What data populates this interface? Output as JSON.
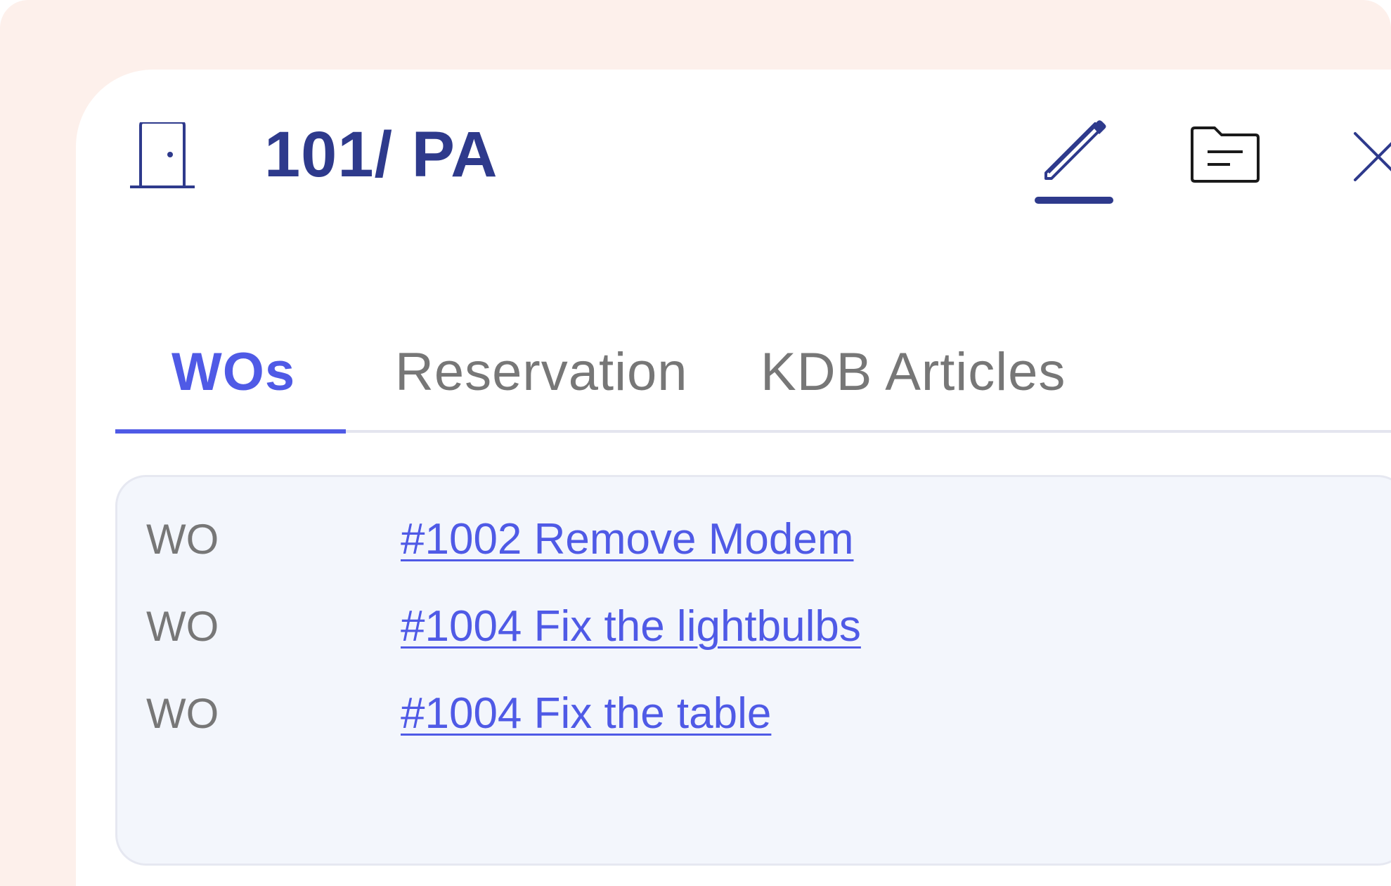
{
  "header": {
    "room_icon": "door-icon",
    "title": "101/ PA",
    "actions": {
      "edit_icon": "pencil-icon",
      "folder_icon": "folder-icon",
      "close_icon": "close-icon"
    }
  },
  "tabs": [
    {
      "label": "WOs",
      "active": true
    },
    {
      "label": "Reservation",
      "active": false
    },
    {
      "label": "KDB Articles",
      "active": false
    }
  ],
  "work_orders": [
    {
      "type": "WO",
      "link": "#1002 Remove Modem"
    },
    {
      "type": "WO",
      "link": "#1004 Fix the lightbulbs"
    },
    {
      "type": "WO",
      "link": "#1004 Fix the table"
    }
  ],
  "colors": {
    "backdrop": "#fdf0eb",
    "title": "#2e3a8c",
    "accent": "#4f5ae6",
    "muted_text": "#777777",
    "card_bg": "#f3f6fc"
  }
}
